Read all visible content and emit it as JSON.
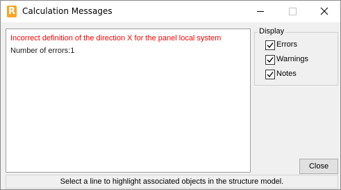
{
  "window": {
    "title": "Calculation Messages",
    "app_icon_letter": "R",
    "app_icon_color": "#f5a623"
  },
  "window_controls": {
    "minimize_icon": "minimize-icon",
    "maximize_icon": "maximize-icon",
    "close_icon": "close-icon"
  },
  "messages": {
    "items": [
      {
        "text": "Incorrect definition of the direction X for the panel local system",
        "color": "#ff0000"
      },
      {
        "text": "Number of errors:1",
        "color": "#1a1a1a"
      }
    ]
  },
  "display": {
    "legend": "Display",
    "options": [
      {
        "label": "Errors",
        "checked": true
      },
      {
        "label": "Warnings",
        "checked": true
      },
      {
        "label": "Notes",
        "checked": true
      }
    ]
  },
  "buttons": {
    "close_label": "Close"
  },
  "status": {
    "text": "Select a line to highlight associated objects in the structure model."
  }
}
